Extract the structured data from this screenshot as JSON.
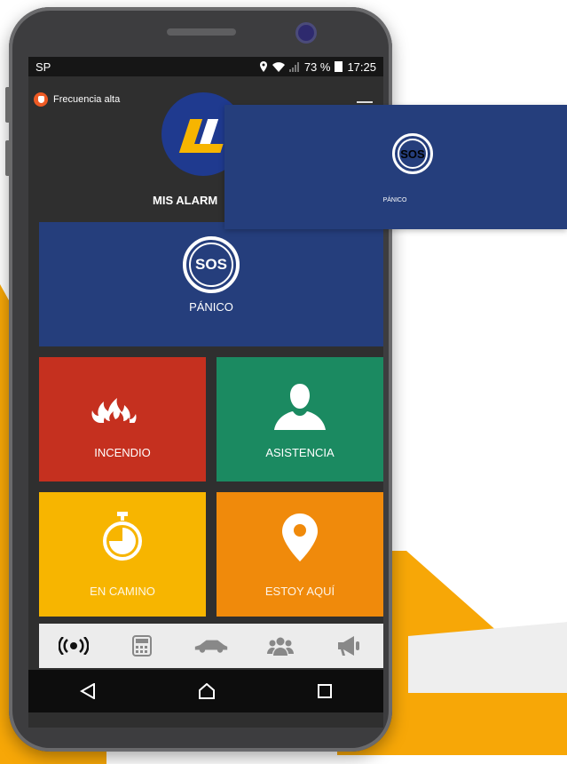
{
  "status_bar": {
    "carrier": "SP",
    "battery": "73 %",
    "time": "17:25"
  },
  "header": {
    "frequency_label": "Frecuencia alta",
    "section_title": "MIS ALARM"
  },
  "tiles": {
    "panic": {
      "label": "PÁNICO",
      "badge": "SOS"
    },
    "fire": {
      "label": "INCENDIO"
    },
    "assist": {
      "label": "ASISTENCIA"
    },
    "en_camino": {
      "label": "EN CAMINO"
    },
    "estoy_aqui": {
      "label": "ESTOY AQUÍ"
    }
  },
  "bottom_nav": {
    "items": [
      "alarm-broadcast-icon",
      "calculator-icon",
      "car-icon",
      "group-icon",
      "megaphone-icon"
    ],
    "active": "alarm-broadcast-icon"
  },
  "zoom_callout": {
    "badge": "SOS",
    "label": "PÁNICO"
  },
  "colors": {
    "panic": "#253e7c",
    "fire": "#c5301f",
    "assist": "#1b8a61",
    "en_camino": "#f7b500",
    "estoy_aqui": "#f08a0b",
    "accent_yellow": "#f7a707"
  }
}
